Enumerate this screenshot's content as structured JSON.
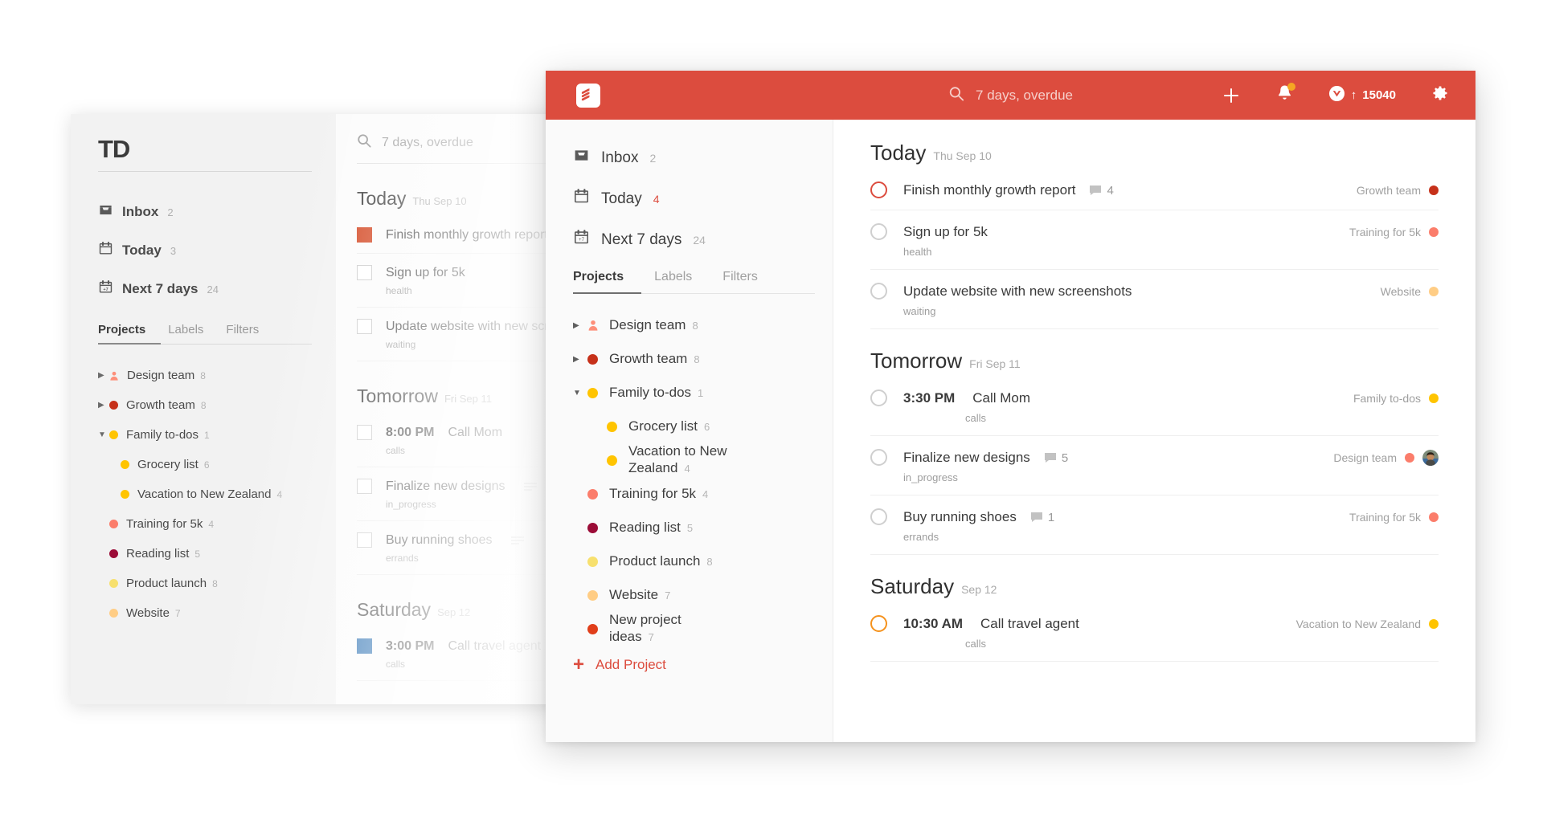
{
  "colors": {
    "brand_red": "#dc4c3e",
    "design_team": "#fd8f7a",
    "growth_team": "#c6311a",
    "family_todos": "#ffc400",
    "grocery_list": "#ffc400",
    "vacation_nz": "#ffc400",
    "training_5k": "#fb7d6b",
    "reading_list": "#9b0c37",
    "product_launch": "#f7e06e",
    "website": "#ffcd85",
    "new_project_ideas": "#e03e1a",
    "priority1": "#dc4c3e",
    "priority2": "#f5921d",
    "bg_priority_square_red": "#d2411b",
    "bg_priority_square_blue": "#1863ab"
  },
  "background_window": {
    "logo": "TD",
    "nav": [
      {
        "label": "Inbox",
        "count": "2",
        "icon": "inbox-icon"
      },
      {
        "label": "Today",
        "count": "3",
        "icon": "calendar-icon"
      },
      {
        "label": "Next 7 days",
        "count": "24",
        "icon": "calendar-7-icon"
      }
    ],
    "tabs": [
      {
        "label": "Projects",
        "active": true
      },
      {
        "label": "Labels",
        "active": false
      },
      {
        "label": "Filters",
        "active": false
      }
    ],
    "projects": [
      {
        "label": "Design team",
        "count": "8",
        "caret": "collapsed",
        "swatch": "person",
        "color": "#fd8f7a",
        "child": false
      },
      {
        "label": "Growth team",
        "count": "8",
        "caret": "collapsed",
        "swatch": "dot",
        "color": "#c6311a",
        "child": false
      },
      {
        "label": "Family to-dos",
        "count": "1",
        "caret": "expanded",
        "swatch": "dot",
        "color": "#ffc400",
        "child": false
      },
      {
        "label": "Grocery list",
        "count": "6",
        "caret": "none",
        "swatch": "dot",
        "color": "#ffc400",
        "child": true
      },
      {
        "label": "Vacation to New Zealand",
        "count": "4",
        "caret": "none",
        "swatch": "dot",
        "color": "#ffc400",
        "child": true
      },
      {
        "label": "Training for 5k",
        "count": "4",
        "caret": "none",
        "swatch": "dot",
        "color": "#fb7d6b",
        "child": false
      },
      {
        "label": "Reading list",
        "count": "5",
        "caret": "none",
        "swatch": "dot",
        "color": "#9b0c37",
        "child": false
      },
      {
        "label": "Product launch",
        "count": "8",
        "caret": "none",
        "swatch": "dot",
        "color": "#f7e06e",
        "child": false
      },
      {
        "label": "Website",
        "count": "7",
        "caret": "none",
        "swatch": "dot",
        "color": "#ffcd85",
        "child": false
      }
    ],
    "search": {
      "value": "7 days, overdue"
    },
    "sections": [
      {
        "title": "Today",
        "date": "Thu Sep 10",
        "tasks": [
          {
            "time": "",
            "title": "Finish monthly growth report",
            "label": "",
            "checkbox": "filled-red",
            "note": false
          },
          {
            "time": "",
            "title": "Sign up for 5k",
            "label": "health",
            "checkbox": "empty",
            "note": false
          },
          {
            "time": "",
            "title": "Update website with new screenshots",
            "label": "waiting",
            "checkbox": "empty",
            "note": false
          }
        ]
      },
      {
        "title": "Tomorrow",
        "date": "Fri Sep 11",
        "tasks": [
          {
            "time": "8:00 PM",
            "title": "Call Mom",
            "label": "calls",
            "checkbox": "empty",
            "note": false
          },
          {
            "time": "",
            "title": "Finalize new designs",
            "label": "in_progress",
            "checkbox": "empty",
            "note": true
          },
          {
            "time": "",
            "title": "Buy running shoes",
            "label": "errands",
            "checkbox": "empty",
            "note": true
          }
        ]
      },
      {
        "title": "Saturday",
        "date": "Sep 12",
        "tasks": [
          {
            "time": "3:00 PM",
            "title": "Call travel agent",
            "label": "calls",
            "checkbox": "filled-blue",
            "note": false
          }
        ]
      }
    ]
  },
  "foreground_window": {
    "topbar": {
      "logo_icon": "todoist-logo-icon",
      "search": {
        "value": "7 days, overdue",
        "placeholder": "Search",
        "icon": "search-icon"
      },
      "add_icon": "plus-icon",
      "notifications_icon": "bell-icon",
      "karma": {
        "icon": "karma-icon",
        "arrow": "↑",
        "value": "15040"
      },
      "settings_icon": "gear-icon"
    },
    "sidebar": {
      "nav": [
        {
          "label": "Inbox",
          "count": "2",
          "count_highlight": false,
          "icon": "inbox-icon"
        },
        {
          "label": "Today",
          "count": "4",
          "count_highlight": true,
          "icon": "calendar-icon"
        },
        {
          "label": "Next 7 days",
          "count": "24",
          "count_highlight": false,
          "icon": "calendar-7-icon"
        }
      ],
      "tabs": [
        {
          "label": "Projects",
          "active": true
        },
        {
          "label": "Labels",
          "active": false
        },
        {
          "label": "Filters",
          "active": false
        }
      ],
      "projects": [
        {
          "label": "Design team",
          "count": "8",
          "caret": "collapsed",
          "swatch": "person",
          "color": "#fd8f7a",
          "child": false
        },
        {
          "label": "Growth team",
          "count": "8",
          "caret": "collapsed",
          "swatch": "dot",
          "color": "#c6311a",
          "child": false
        },
        {
          "label": "Family to-dos",
          "count": "1",
          "caret": "expanded",
          "swatch": "dot",
          "color": "#ffc400",
          "child": false
        },
        {
          "label": "Grocery list",
          "count": "6",
          "caret": "none",
          "swatch": "dot",
          "color": "#ffc400",
          "child": true
        },
        {
          "label": "Vacation to New Zealand",
          "count": "4",
          "caret": "none",
          "swatch": "dot",
          "color": "#ffc400",
          "child": true
        },
        {
          "label": "Training for 5k",
          "count": "4",
          "caret": "none",
          "swatch": "dot",
          "color": "#fb7d6b",
          "child": false
        },
        {
          "label": "Reading list",
          "count": "5",
          "caret": "none",
          "swatch": "dot",
          "color": "#9b0c37",
          "child": false
        },
        {
          "label": "Product launch",
          "count": "8",
          "caret": "none",
          "swatch": "dot",
          "color": "#f7e06e",
          "child": false
        },
        {
          "label": "Website",
          "count": "7",
          "caret": "none",
          "swatch": "dot",
          "color": "#ffcd85",
          "child": false
        },
        {
          "label": "New project ideas",
          "count": "7",
          "caret": "none",
          "swatch": "dot",
          "color": "#e03e1a",
          "child": false
        }
      ],
      "add_project": {
        "label": "Add Project",
        "icon": "plus-icon"
      }
    },
    "sections": [
      {
        "title": "Today",
        "date": "Thu Sep 10",
        "tasks": [
          {
            "time": "",
            "title": "Finish monthly growth report",
            "comments": "4",
            "label": "",
            "project": "Growth team",
            "project_color": "#c6311a",
            "priority": "p1",
            "avatar": false
          },
          {
            "time": "",
            "title": "Sign up for 5k",
            "comments": "",
            "label": "health",
            "project": "Training for 5k",
            "project_color": "#fb7d6b",
            "priority": "none",
            "avatar": false
          },
          {
            "time": "",
            "title": "Update website with new screenshots",
            "comments": "",
            "label": "waiting",
            "project": "Website",
            "project_color": "#ffcd85",
            "priority": "none",
            "avatar": false
          }
        ]
      },
      {
        "title": "Tomorrow",
        "date": "Fri Sep 11",
        "tasks": [
          {
            "time": "3:30 PM",
            "title": "Call Mom",
            "comments": "",
            "label": "calls",
            "project": "Family to-dos",
            "project_color": "#ffc400",
            "priority": "none",
            "avatar": false
          },
          {
            "time": "",
            "title": "Finalize new designs",
            "comments": "5",
            "label": "in_progress",
            "project": "Design team",
            "project_color": "#fb7d6b",
            "priority": "none",
            "avatar": true
          },
          {
            "time": "",
            "title": "Buy running shoes",
            "comments": "1",
            "label": "errands",
            "project": "Training for 5k",
            "project_color": "#fb7d6b",
            "priority": "none",
            "avatar": false
          }
        ]
      },
      {
        "title": "Saturday",
        "date": "Sep 12",
        "tasks": [
          {
            "time": "10:30 AM",
            "title": "Call travel agent",
            "comments": "",
            "label": "calls",
            "project": "Vacation to New Zealand",
            "project_color": "#ffc400",
            "priority": "p2",
            "avatar": false
          }
        ]
      }
    ]
  }
}
